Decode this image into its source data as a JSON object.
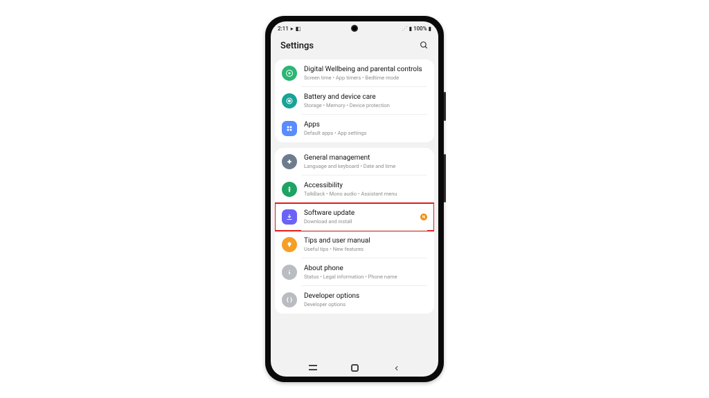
{
  "statusbar": {
    "time": "2:11",
    "battery_pct": "100%"
  },
  "header": {
    "title": "Settings"
  },
  "groups": [
    {
      "items": [
        {
          "id": "wellbeing",
          "title": "Digital Wellbeing and parental controls",
          "sub": "Screen time  •  App timers  •  Bedtime mode",
          "color": "#2bb673",
          "icon": "wellbeing"
        },
        {
          "id": "battery",
          "title": "Battery and device care",
          "sub": "Storage  •  Memory  •  Device protection",
          "color": "#17a398",
          "icon": "care"
        },
        {
          "id": "apps",
          "title": "Apps",
          "sub": "Default apps  •  App settings",
          "color": "#5a8cff",
          "icon": "apps",
          "shape": "rounded-square"
        }
      ]
    },
    {
      "items": [
        {
          "id": "general",
          "title": "General management",
          "sub": "Language and keyboard  •  Date and time",
          "color": "#6d7c8d",
          "icon": "gear"
        },
        {
          "id": "accessibility",
          "title": "Accessibility",
          "sub": "TalkBack  •  Mono audio  •  Assistant menu",
          "color": "#1ea362",
          "icon": "person"
        },
        {
          "id": "software",
          "title": "Software update",
          "sub": "Download and install",
          "color": "#6b63f6",
          "icon": "download",
          "shape": "rounded-square",
          "badge": "N",
          "highlight": true
        },
        {
          "id": "tips",
          "title": "Tips and user manual",
          "sub": "Useful tips  •  New features",
          "color": "#f59f26",
          "icon": "bulb"
        },
        {
          "id": "about",
          "title": "About phone",
          "sub": "Status  •  Legal information  •  Phone name",
          "color": "#b9bcc0",
          "icon": "info"
        },
        {
          "id": "developer",
          "title": "Developer options",
          "sub": "Developer options",
          "color": "#b9bcc0",
          "icon": "braces"
        }
      ]
    }
  ]
}
